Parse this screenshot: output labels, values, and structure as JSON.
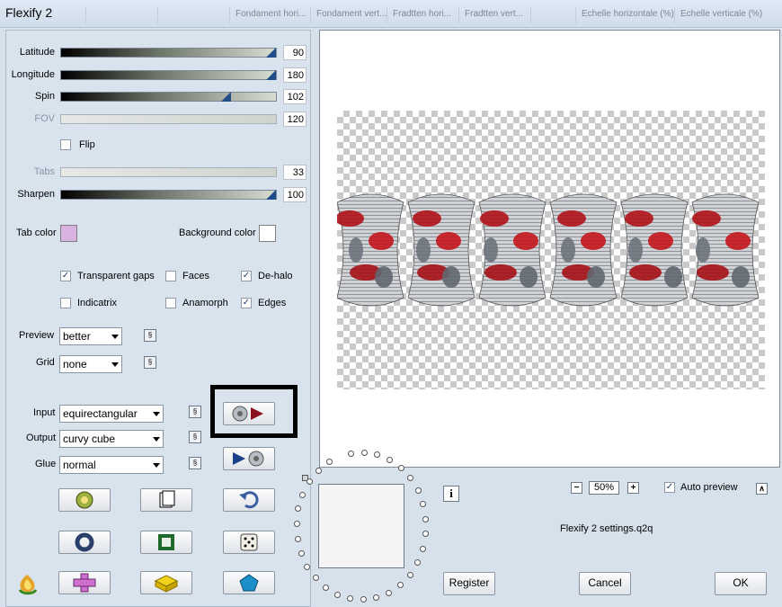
{
  "window": {
    "title": "Flexify 2",
    "background_tabs": [
      "",
      "",
      "Fondament hori...",
      "Fondament vert...",
      "Fradtten hori...",
      "Fradtten vert...",
      "",
      "Echelle horizontale (%)",
      "Echelle verticale (%)"
    ]
  },
  "sliders": [
    {
      "label": "Latitude",
      "value": "90",
      "level": 1.0,
      "enabled": true
    },
    {
      "label": "Longitude",
      "value": "180",
      "level": 1.0,
      "enabled": true
    },
    {
      "label": "Spin",
      "value": "102",
      "level": 0.78,
      "enabled": true
    },
    {
      "label": "FOV",
      "value": "120",
      "level": 0.0,
      "enabled": false
    },
    {
      "label": "Tabs",
      "value": "33",
      "level": 0.0,
      "enabled": false
    },
    {
      "label": "Sharpen",
      "value": "100",
      "level": 1.0,
      "enabled": true
    }
  ],
  "flip": {
    "label": "Flip",
    "checked": false
  },
  "colors": {
    "tab_color_label": "Tab color",
    "tab_color": "#d9b4e3",
    "background_color_label": "Background color",
    "background_color": "#ffffff",
    "accent": "#1f4d8a"
  },
  "options": [
    {
      "label": "Transparent gaps",
      "checked": true
    },
    {
      "label": "Faces",
      "checked": false
    },
    {
      "label": "De-halo",
      "checked": true
    },
    {
      "label": "Indicatrix",
      "checked": false
    },
    {
      "label": "Anamorph",
      "checked": false
    },
    {
      "label": "Edges",
      "checked": true
    }
  ],
  "selects": {
    "preview": {
      "label": "Preview",
      "value": "better"
    },
    "grid": {
      "label": "Grid",
      "value": "none"
    },
    "input": {
      "label": "Input",
      "value": "equirectangular"
    },
    "output": {
      "label": "Output",
      "value": "curvy cube"
    },
    "glue": {
      "label": "Glue",
      "value": "normal"
    }
  },
  "tool_buttons": [
    "randomize-icon",
    "new-page-icon",
    "undo-arrow-icon",
    "ring-icon",
    "frame-icon",
    "dice-icon",
    "cross-icon",
    "brick-icon",
    "gem-icon"
  ],
  "zoom": {
    "level": "50%",
    "minus": "−",
    "plus": "+"
  },
  "auto_preview": {
    "label": "Auto preview",
    "checked": true
  },
  "settings_file": "Flexify 2 settings.q2q",
  "buttons": {
    "register": "Register",
    "cancel": "Cancel",
    "ok": "OK"
  },
  "info_icon": "i"
}
